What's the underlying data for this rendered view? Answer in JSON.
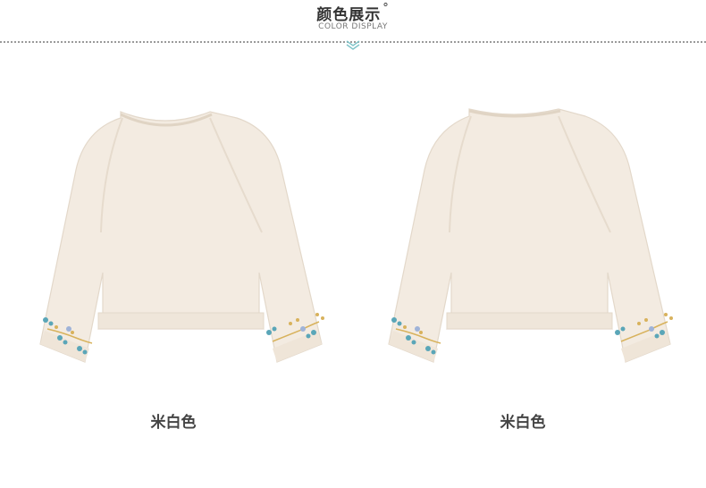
{
  "header": {
    "title": "颜色展示",
    "title_mark": "°",
    "subtitle": "COLOR DISPLAY"
  },
  "products": [
    {
      "view": "front",
      "color_label": "米白色"
    },
    {
      "view": "back",
      "color_label": "米白色"
    }
  ],
  "colors": {
    "sweater": "#f3ebe1",
    "sweater_shade": "#e6dbcd",
    "embroidery_blue": "#5aa6b8",
    "embroidery_gold": "#d8b25c",
    "embroidery_lilac": "#9fb3d8",
    "accent": "#7fc4c9"
  },
  "icons": [
    "chevron-down-icon"
  ]
}
